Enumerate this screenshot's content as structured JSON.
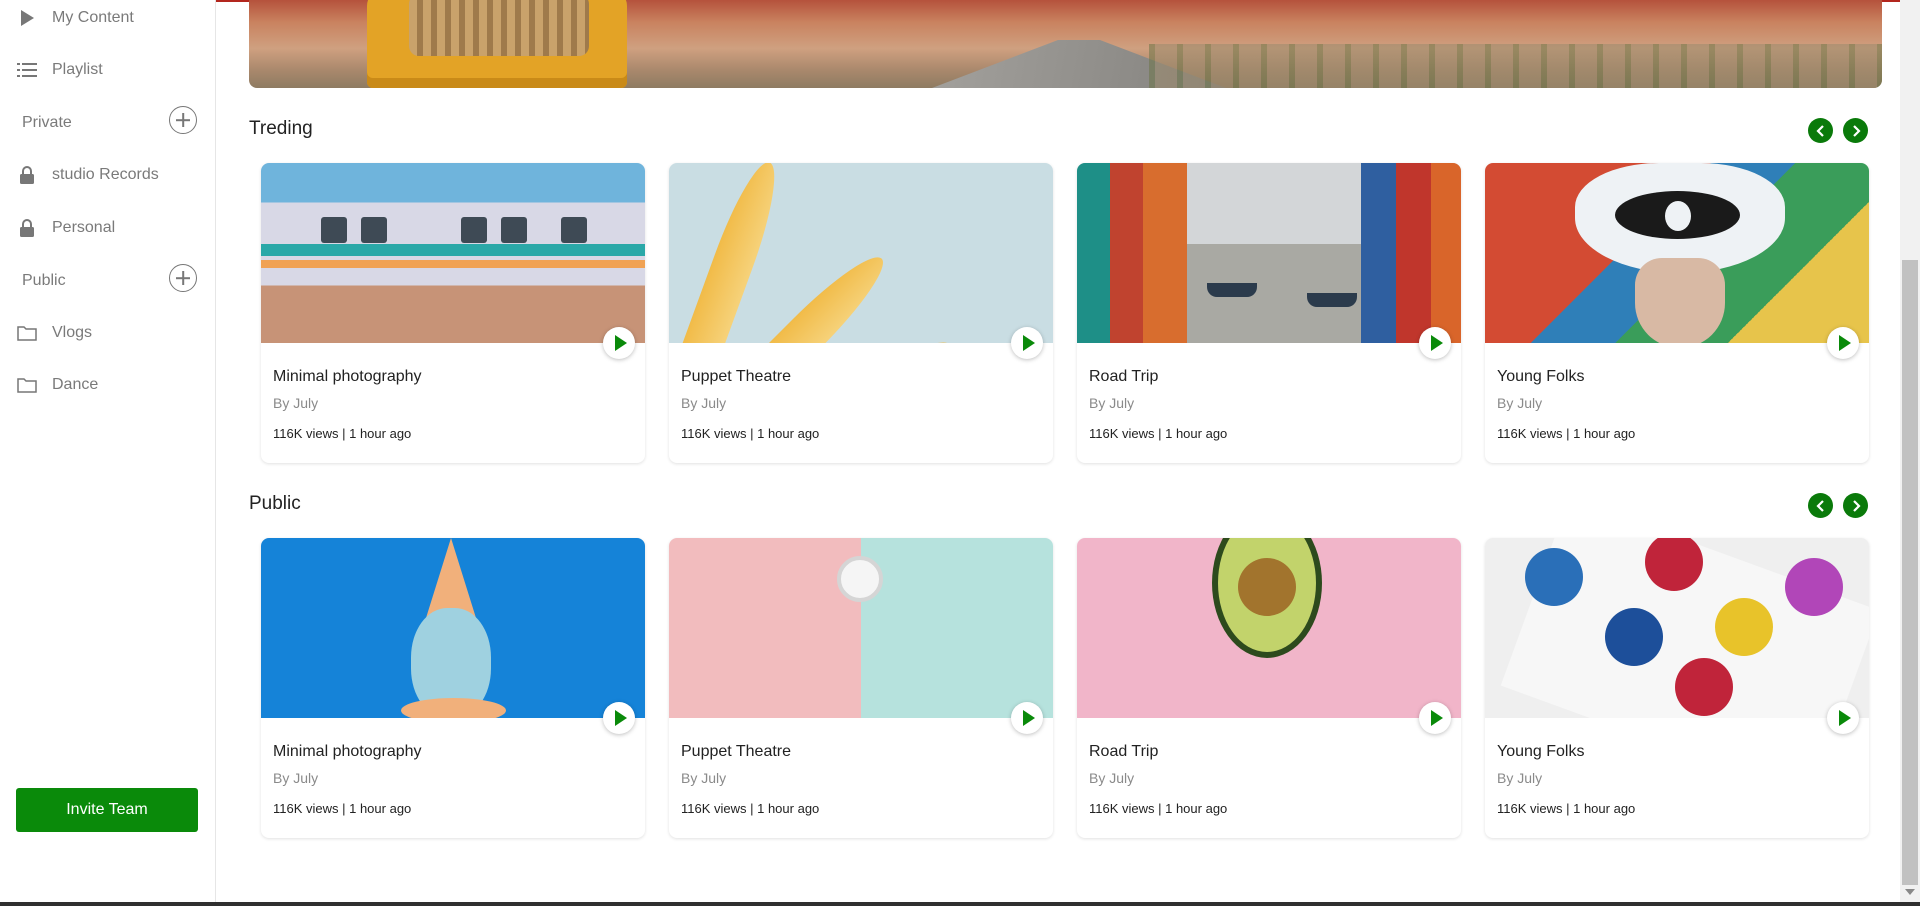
{
  "sidebar": {
    "items": [
      {
        "label": "My Content",
        "icon": "play-icon"
      },
      {
        "label": "Playlist",
        "icon": "list-icon"
      }
    ],
    "private_heading": "Private",
    "private_items": [
      {
        "label": "studio Records",
        "icon": "lock-icon"
      },
      {
        "label": "Personal",
        "icon": "lock-icon"
      }
    ],
    "public_heading": "Public",
    "public_items": [
      {
        "label": "Vlogs",
        "icon": "folder-icon"
      },
      {
        "label": "Dance",
        "icon": "folder-icon"
      }
    ],
    "invite_label": "Invite Team"
  },
  "sections": [
    {
      "title": "Treding",
      "cards": [
        {
          "title": "Minimal photography",
          "by": "By July",
          "meta": "116K views | 1 hour ago"
        },
        {
          "title": "Puppet Theatre",
          "by": "By July",
          "meta": "116K views | 1 hour ago"
        },
        {
          "title": "Road Trip",
          "by": "By July",
          "meta": "116K views | 1 hour ago"
        },
        {
          "title": "Young Folks",
          "by": "By July",
          "meta": "116K views | 1 hour ago"
        }
      ]
    },
    {
      "title": "Public",
      "cards": [
        {
          "title": "Minimal photography",
          "by": "By July",
          "meta": "116K views | 1 hour ago"
        },
        {
          "title": "Puppet Theatre",
          "by": "By July",
          "meta": "116K views | 1 hour ago"
        },
        {
          "title": "Road Trip",
          "by": "By July",
          "meta": "116K views | 1 hour ago"
        },
        {
          "title": "Young Folks",
          "by": "By July",
          "meta": "116K views | 1 hour ago"
        }
      ]
    }
  ],
  "colors": {
    "accent": "#0a8a0a",
    "nav_button": "#0a7a0a",
    "top_line": "#b3261e"
  }
}
